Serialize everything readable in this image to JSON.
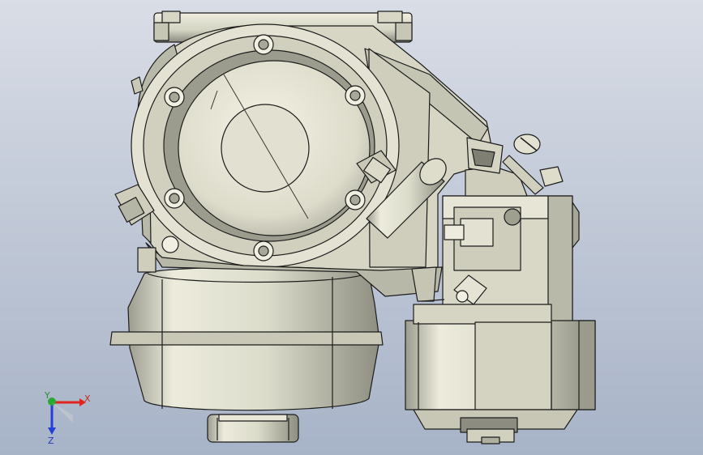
{
  "viewport": {
    "background_top": "#d9dde6",
    "background_bottom": "#a7b3c7",
    "triad": {
      "x_label": "X",
      "y_label": "Y",
      "z_label": "Z",
      "x_color": "#e0231d",
      "y_color": "#29a833",
      "z_color": "#243fd6"
    },
    "part": {
      "metal_light": "#eeeede",
      "metal_mid": "#cfcfbd",
      "metal_dark": "#8f8f82",
      "edge": "#1c1c1c",
      "shadow": "#6f6f66"
    }
  }
}
